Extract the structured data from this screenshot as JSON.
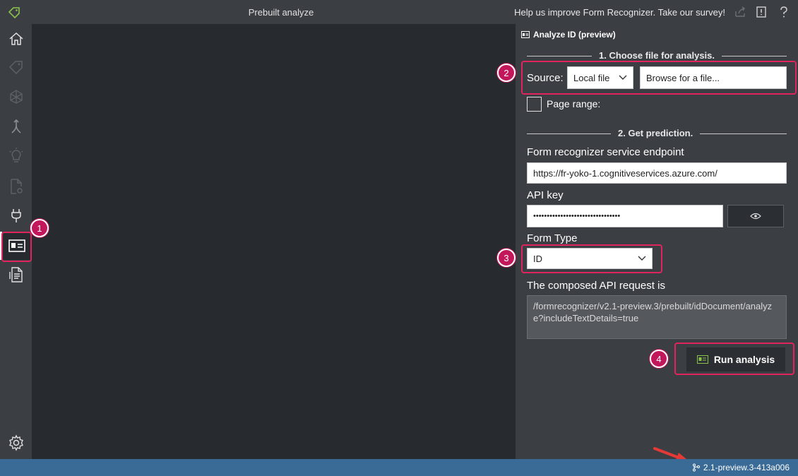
{
  "titlebar": {
    "title": "Prebuilt analyze",
    "survey_text": "Help us improve Form Recognizer. Take our survey!"
  },
  "icons": {
    "logo": "tag-logo-icon",
    "share": "share-icon",
    "feedback": "feedback-icon",
    "help": "help-icon"
  },
  "rail": {
    "items": [
      "home-icon",
      "tag-icon",
      "connections-icon",
      "merge-icon",
      "lightbulb-icon",
      "document-settings-icon",
      "plug-icon",
      "id-card-icon",
      "document-list-icon",
      "settings-icon"
    ],
    "active": "id-card-icon"
  },
  "panel": {
    "header": "Analyze ID (preview)",
    "section1_title": "1. Choose file for analysis.",
    "source_label": "Source:",
    "source_value": "Local file",
    "browse_label": "Browse for a file...",
    "page_range_label": "Page range:",
    "section2_title": "2. Get prediction.",
    "endpoint_label": "Form recognizer service endpoint",
    "endpoint_value": "https://fr-yoko-1.cognitiveservices.azure.com/",
    "apikey_label": "API key",
    "apikey_value": "••••••••••••••••••••••••••••••••",
    "formtype_label": "Form Type",
    "formtype_value": "ID",
    "composed_label": "The composed API request is",
    "composed_value": "/formrecognizer/v2.1-preview.3/prebuilt/idDocument/analyze?includeTextDetails=true",
    "run_label": "Run analysis"
  },
  "annotations": [
    "1",
    "2",
    "3",
    "4"
  ],
  "status": {
    "version": "2.1-preview.3-413a006"
  },
  "colors": {
    "accent": "#e0245e",
    "statusbar": "#3a6a96",
    "logo_green": "#8bc34a"
  }
}
